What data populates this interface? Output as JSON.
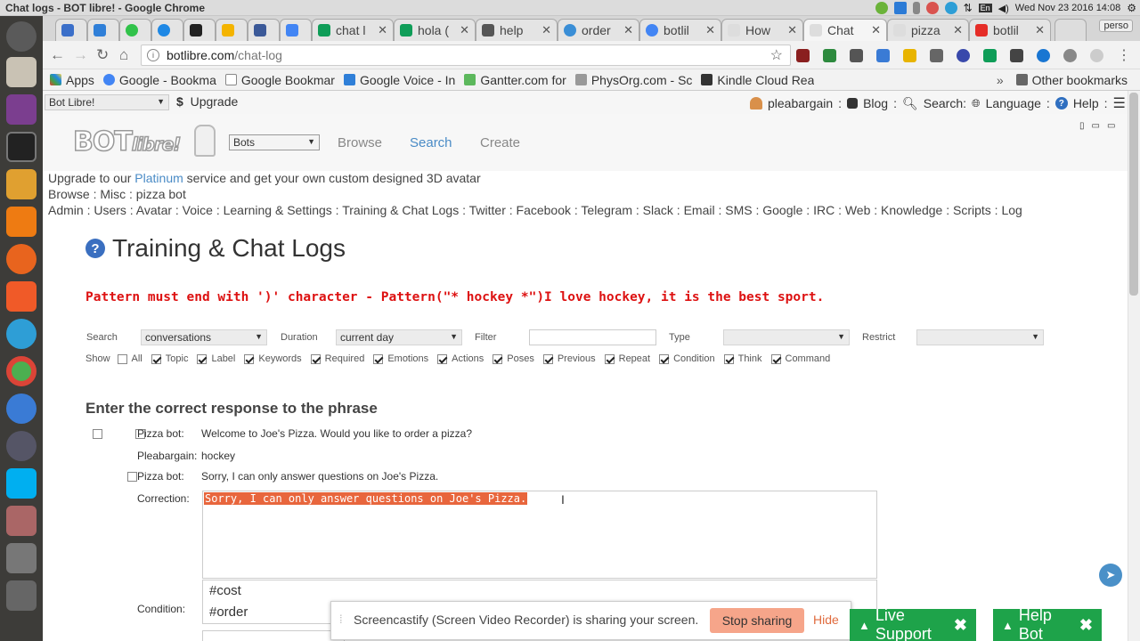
{
  "os": {
    "window_title": "Chat logs - BOT libre! - Google Chrome",
    "clock": "Wed Nov 23 2016 14:08",
    "keyboard": "En",
    "tray_icons": [
      "green-circle-icon",
      "bluetooth-icon",
      "microphone-icon",
      "alarm-icon",
      "telegram-icon",
      "network-icon",
      "keyboard-icon",
      "volume-icon",
      "gear-icon"
    ]
  },
  "tabs": [
    {
      "label": "",
      "icon": "mail-icon"
    },
    {
      "label": "",
      "icon": "phone-icon"
    },
    {
      "label": "",
      "icon": "whatsapp-icon"
    },
    {
      "label": "",
      "icon": "messenger-icon"
    },
    {
      "label": "",
      "icon": "amazon-icon"
    },
    {
      "label": "",
      "icon": "keep-icon"
    },
    {
      "label": "",
      "icon": "facebook-icon"
    },
    {
      "label": "",
      "icon": "calendar-icon"
    },
    {
      "label": "chat l",
      "icon": "sheets-icon"
    },
    {
      "label": "hola (",
      "icon": "sheets-icon"
    },
    {
      "label": "help",
      "icon": "hash-icon"
    },
    {
      "label": "order",
      "icon": "gear-icon"
    },
    {
      "label": "botlil",
      "icon": "google-icon"
    },
    {
      "label": "How",
      "icon": "page-icon"
    },
    {
      "label": "Chat",
      "icon": "page-icon",
      "active": true
    },
    {
      "label": "pizza",
      "icon": "page-icon"
    },
    {
      "label": "botlil",
      "icon": "youtube-icon"
    }
  ],
  "profile_label": "perso",
  "toolbar": {
    "url_domain": "botlibre.com",
    "url_path": "/chat-log"
  },
  "bookmarks": {
    "apps": "Apps",
    "items": [
      "Google - Bookma",
      "Google Bookmar",
      "Google Voice - In",
      "Gantter.com for",
      "PhysOrg.com - Sc",
      "Kindle Cloud Rea"
    ],
    "overflow": "»",
    "other": "Other bookmarks"
  },
  "site": {
    "top_select": "Bot Libre!",
    "upgrade": "Upgrade",
    "user": "pleabargain",
    "blog": "Blog",
    "search": "Search:",
    "language": "Language",
    "help": "Help",
    "logo_main": "BOT",
    "logo_sub": "libre!",
    "type_select": "Bots",
    "nav": [
      "Browse",
      "Search",
      "Create"
    ],
    "upgrade_prefix": "Upgrade to our ",
    "upgrade_highlight": "Platinum",
    "upgrade_suffix": " service and get your own custom designed 3D avatar",
    "breadcrumb": "Browse : Misc : pizza bot",
    "admin_menu": "Admin : Users : Avatar : Voice : Learning & Settings : Training & Chat Logs : Twitter : Facebook : Telegram : Slack : Email : SMS : Google : IRC : Web : Knowledge : Scripts : Log"
  },
  "main": {
    "title": "Training & Chat Logs",
    "error": "Pattern must end with ')' character - Pattern(\"* hockey *\")I love hockey, it is the best sport.",
    "filters": {
      "search_label": "Search",
      "search_value": "conversations",
      "duration_label": "Duration",
      "duration_value": "current day",
      "filter_label": "Filter",
      "filter_value": "",
      "type_label": "Type",
      "type_value": "",
      "restrict_label": "Restrict",
      "restrict_value": ""
    },
    "show_label": "Show",
    "show_options": [
      {
        "label": "All",
        "checked": false
      },
      {
        "label": "Topic",
        "checked": true
      },
      {
        "label": "Label",
        "checked": true
      },
      {
        "label": "Keywords",
        "checked": true
      },
      {
        "label": "Required",
        "checked": true
      },
      {
        "label": "Emotions",
        "checked": true
      },
      {
        "label": "Actions",
        "checked": true
      },
      {
        "label": "Poses",
        "checked": true
      },
      {
        "label": "Previous",
        "checked": true
      },
      {
        "label": "Repeat",
        "checked": true
      },
      {
        "label": "Condition",
        "checked": true
      },
      {
        "label": "Think",
        "checked": true
      },
      {
        "label": "Command",
        "checked": true
      }
    ],
    "section_title": "Enter the correct response to the phrase",
    "rows": [
      {
        "speaker": "Pizza bot:",
        "text": "Welcome to Joe's Pizza. Would you like to order a pizza?"
      },
      {
        "speaker": "Pleabargain:",
        "text": "hockey"
      },
      {
        "speaker": "Pizza bot:",
        "text": "Sorry, I can only answer questions on Joe's Pizza."
      }
    ],
    "correction_label": "Correction:",
    "correction_value": "Sorry, I can only answer questions on Joe's Pizza.",
    "condition_label": "Condition:",
    "condition_lines": [
      "#cost",
      "#order"
    ]
  },
  "cast": {
    "message": "Screencastify (Screen Video Recorder) is sharing your screen.",
    "stop": "Stop sharing",
    "hide": "Hide"
  },
  "support": {
    "live": "Live Support",
    "help": "Help Bot"
  },
  "colors": {
    "error": "#dd1111",
    "link_blue": "#4a8bc6",
    "selection": "#e8663d",
    "support_green": "#1ea34a"
  }
}
